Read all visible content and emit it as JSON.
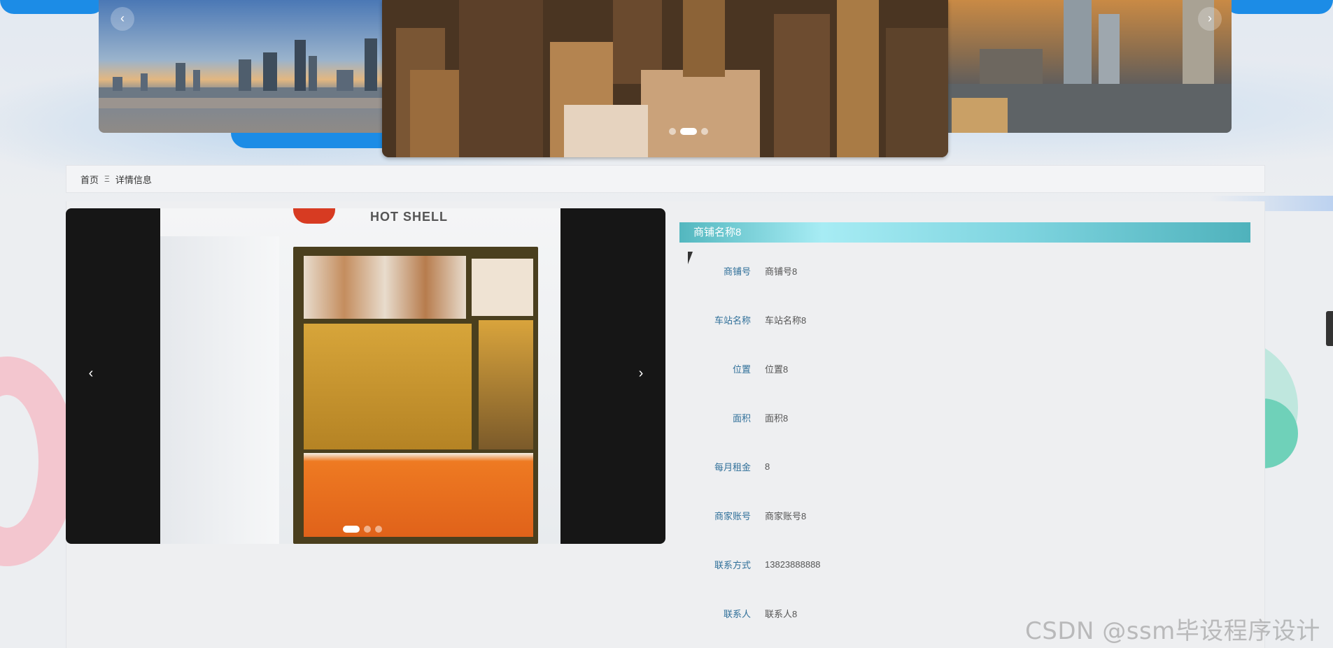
{
  "breadcrumb": {
    "home": "首页",
    "separator": "Ξ",
    "current": "详情信息"
  },
  "banner": {
    "prev_icon": "‹",
    "next_icon": "›",
    "dots": 3,
    "active_dot": 2
  },
  "gallery": {
    "prev_icon": "‹",
    "next_icon": "›",
    "dots": 3,
    "active_dot": 1,
    "sign_text": "HOT SHELL"
  },
  "detail": {
    "title": "商铺名称8",
    "fields": [
      {
        "label": "商铺号",
        "value": "商铺号8"
      },
      {
        "label": "车站名称",
        "value": "车站名称8"
      },
      {
        "label": "位置",
        "value": "位置8"
      },
      {
        "label": "面积",
        "value": "面积8"
      },
      {
        "label": "每月租金",
        "value": "8"
      },
      {
        "label": "商家账号",
        "value": "商家账号8"
      },
      {
        "label": "联系方式",
        "value": "13823888888"
      },
      {
        "label": "联系人",
        "value": "联系人8"
      }
    ]
  },
  "watermark": "CSDN @ssm毕设程序设计",
  "colors": {
    "title_bar": "#53b7bf",
    "label": "#2f6f99",
    "accent_blue": "#1c8ce6"
  }
}
